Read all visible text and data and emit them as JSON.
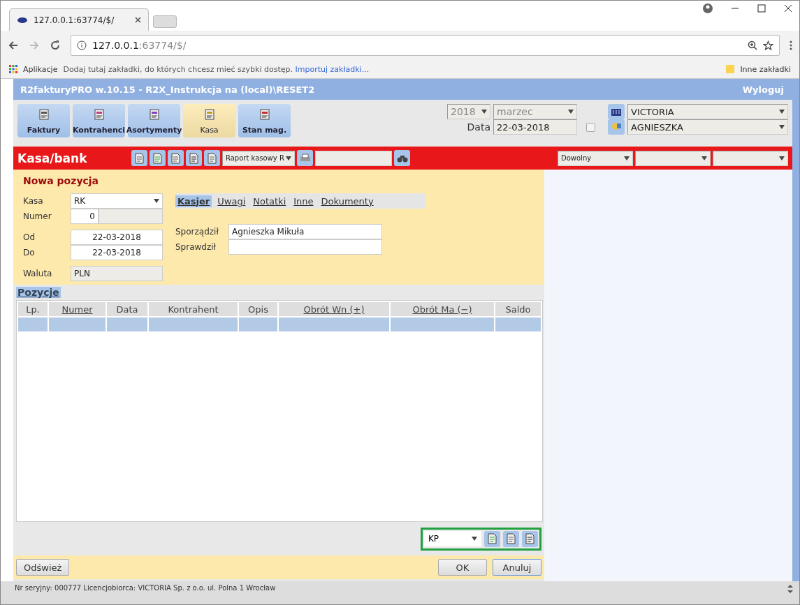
{
  "browser": {
    "tab_title": "127.0.0.1:63774/$/",
    "address": {
      "host": "127.0.0.1",
      "rest": ":63774/$/"
    },
    "bookmarks": {
      "apps": "Aplikacje",
      "hint": "Dodaj tutaj zakładki, do których chcesz mieć szybki dostęp.",
      "import_link": "Importuj zakładki...",
      "other": "Inne zakładki"
    }
  },
  "app": {
    "title": "R2fakturyPRO w.10.15 - R2X_Instrukcja na (local)\\RESET2",
    "logout": "Wyloguj",
    "modules": [
      {
        "label": "Faktury",
        "selected": false
      },
      {
        "label": "Kontrahenci",
        "selected": false
      },
      {
        "label": "Asortymenty",
        "selected": false
      },
      {
        "label": "Kasa",
        "selected": true
      },
      {
        "label": "Stan mag.",
        "selected": false
      }
    ],
    "year": "2018",
    "month": "marzec",
    "date_label": "Data",
    "date": "22-03-2018",
    "date_checked": false,
    "company": "VICTORIA",
    "user": "AGNIESZKA"
  },
  "section": {
    "title": "Kasa/bank",
    "report_select": "Raport kasowy R",
    "filter_1": "Dowolny"
  },
  "form": {
    "heading": "Nowa pozycja",
    "kasa_label": "Kasa",
    "kasa": "RK",
    "numer_label": "Numer",
    "numer": "0",
    "od_label": "Od",
    "od": "22-03-2018",
    "do_label": "Do",
    "do": "22-03-2018",
    "waluta_label": "Waluta",
    "waluta": "PLN",
    "tabs": [
      {
        "label": "Kasjer",
        "selected": true
      },
      {
        "label": "Uwagi",
        "selected": false
      },
      {
        "label": "Notatki",
        "selected": false
      },
      {
        "label": "Inne",
        "selected": false
      },
      {
        "label": "Dokumenty",
        "selected": false
      }
    ],
    "prepared_label": "Sporządził",
    "prepared": "Agnieszka Mikuła",
    "checked_label": "Sprawdził"
  },
  "positions": {
    "heading": "Pozycje",
    "columns": [
      {
        "label": "Lp.",
        "sortable": false
      },
      {
        "label": "Numer",
        "sortable": true
      },
      {
        "label": "Data",
        "sortable": false
      },
      {
        "label": "Kontrahent",
        "sortable": false
      },
      {
        "label": "Opis",
        "sortable": false
      },
      {
        "label": "Obrót Wn (+)",
        "sortable": true
      },
      {
        "label": "Obrót Ma (−)",
        "sortable": true
      },
      {
        "label": "Saldo",
        "sortable": false
      }
    ],
    "doc_type": "KP"
  },
  "buttons": {
    "refresh": "Odśwież",
    "ok": "OK",
    "cancel": "Anuluj"
  },
  "status_bar": "Nr seryjny: 000777 Licencjobiorca: VICTORIA Sp. z o.o. ul. Polna 1 Wrocław"
}
